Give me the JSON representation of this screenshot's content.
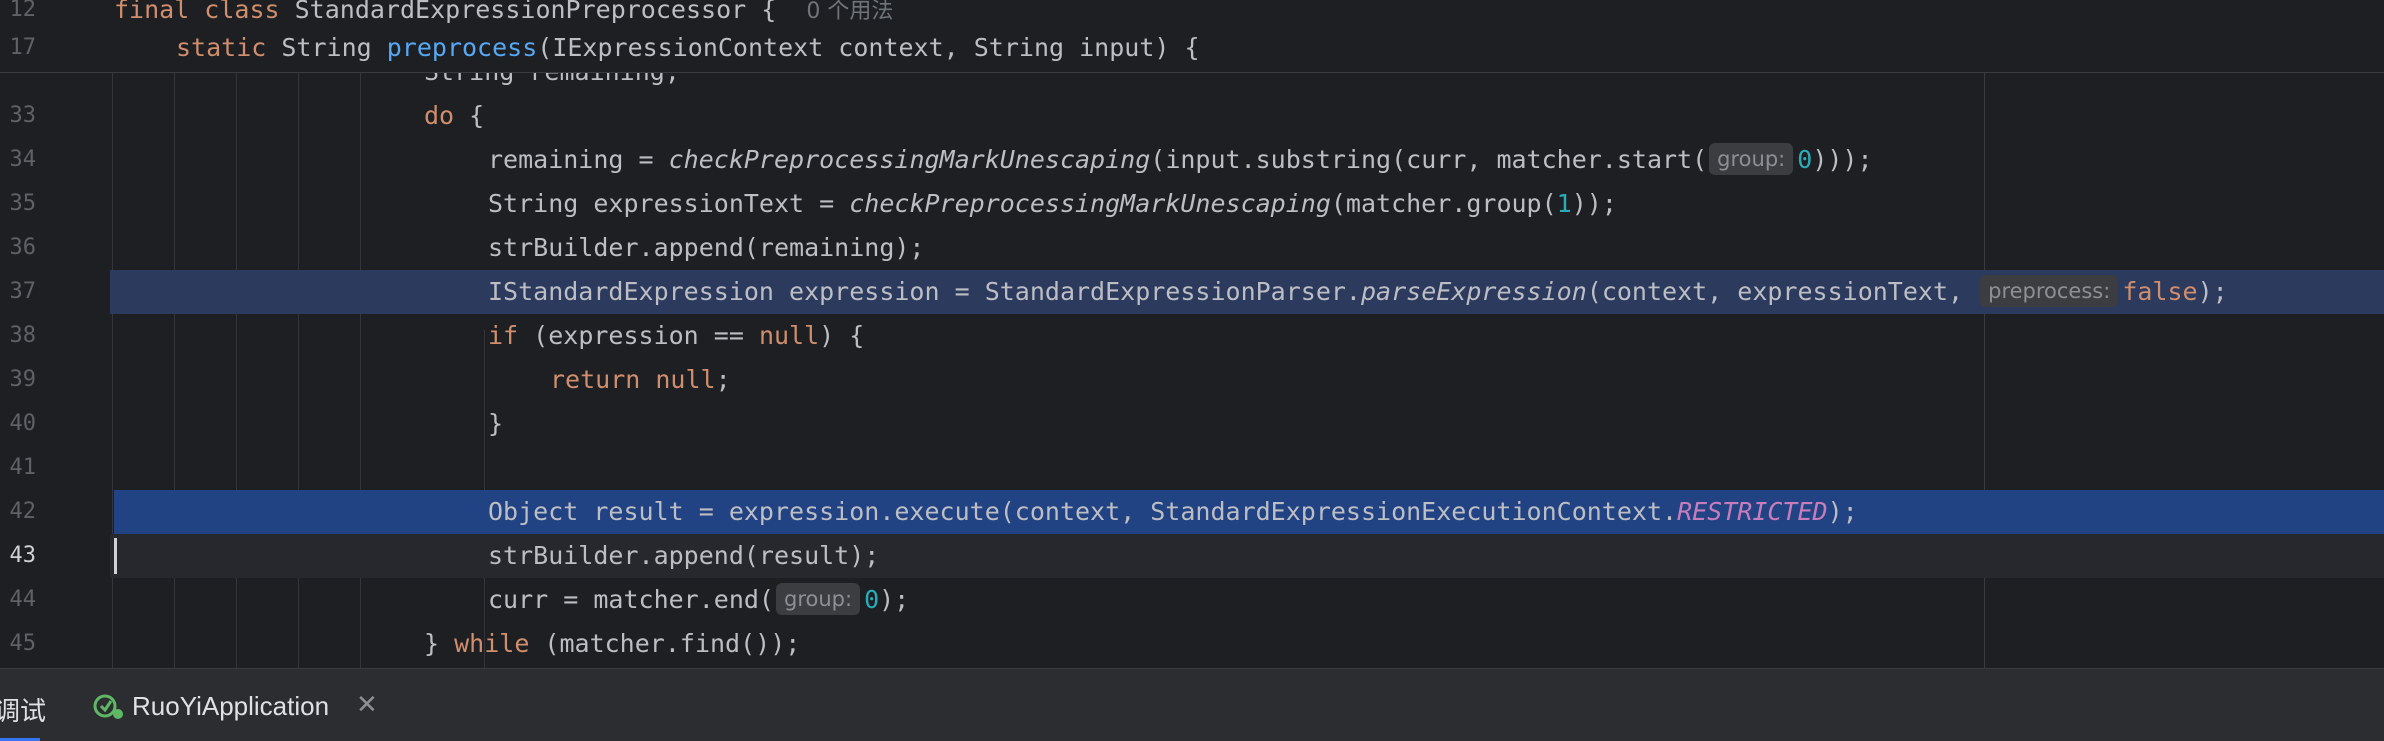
{
  "sticky_header": {
    "line1_number": "12",
    "line1_code": "final class StandardExpressionPreprocessor {",
    "line1_usage": "0 个用法",
    "line2_number": "17",
    "line2_kw": "static",
    "line2_type": "String",
    "line2_method": "preprocess",
    "line2_rest": "(IExpressionContext context, String input) {"
  },
  "code_lines": [
    {
      "n": "33"
    },
    {
      "n": "34"
    },
    {
      "n": "35"
    },
    {
      "n": "36"
    },
    {
      "n": "37"
    },
    {
      "n": "38"
    },
    {
      "n": "39"
    },
    {
      "n": "40"
    },
    {
      "n": "41"
    },
    {
      "n": "42"
    },
    {
      "n": "43"
    },
    {
      "n": "44"
    },
    {
      "n": "45"
    }
  ],
  "partial_line_text": "String remaining;",
  "code": {
    "l33_kw": "do",
    "l33_rest": " {",
    "l34_a": "remaining = ",
    "l34_fn": "checkPreprocessingMarkUnescaping",
    "l34_b": "(input.substring(curr, matcher.start(",
    "l34_hint": "group:",
    "l34_num": "0",
    "l34_c": ")));",
    "l35_a": "String expressionText = ",
    "l35_fn": "checkPreprocessingMarkUnescaping",
    "l35_b": "(matcher.group(",
    "l35_num": "1",
    "l35_c": "));",
    "l36": "strBuilder.append(remaining);",
    "l37_a": "IStandardExpression expression = StandardExpressionParser.",
    "l37_fn": "parseExpression",
    "l37_b": "(context, expressionText, ",
    "l37_hint": "preprocess:",
    "l37_kw": "false",
    "l37_c": ");",
    "l38_kw": "if",
    "l38_a": " (expression == ",
    "l38_null": "null",
    "l38_b": ") {",
    "l39_kw": "return",
    "l39_null": "null",
    "l39_b": ";",
    "l40": "}",
    "l42_a": "Object result = expression.execute(context, StandardExpressionExecutionContext.",
    "l42_const": "RESTRICTED",
    "l42_b": ");",
    "l43": "strBuilder.append(result);",
    "l44_a": "curr = matcher.end(",
    "l44_hint": "group:",
    "l44_num": "0",
    "l44_b": ");",
    "l45_a": "} ",
    "l45_kw": "while",
    "l45_b": " (matcher.find());"
  },
  "bottom_bar": {
    "left_tab": "调试",
    "run_config": "RuoYiApplication",
    "close_icon": "close-icon",
    "run_icon": "debug-run-icon"
  },
  "colors": {
    "background": "#1e1f22",
    "keyword": "#cf8e6d",
    "method": "#56a8f5",
    "number": "#2aacb8",
    "constant": "#c77dbb",
    "breakpoint_line": "#2c3a5e",
    "selected_line": "#214283"
  }
}
